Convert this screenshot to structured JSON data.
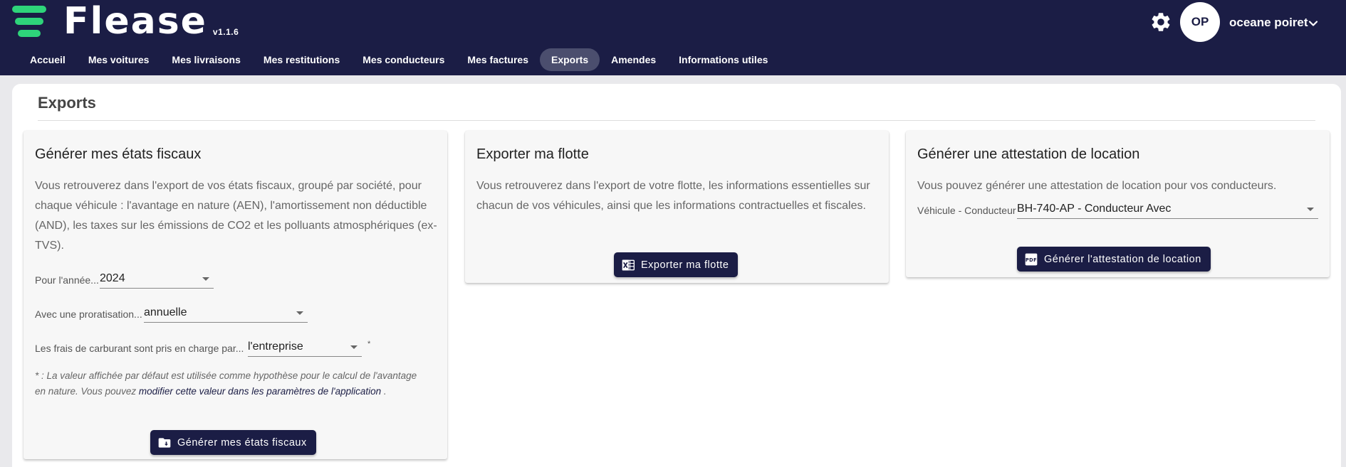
{
  "app": {
    "logo_text": "Flease",
    "version": "v1.1.6",
    "brand_color": "#1b1d45",
    "accent_color": "#2ed47a"
  },
  "user": {
    "initials": "OP",
    "name": "oceane poiret"
  },
  "nav": {
    "items": [
      {
        "label": "Accueil"
      },
      {
        "label": "Mes voitures"
      },
      {
        "label": "Mes livraisons"
      },
      {
        "label": "Mes restitutions"
      },
      {
        "label": "Mes conducteurs"
      },
      {
        "label": "Mes factures"
      },
      {
        "label": "Exports",
        "active": true
      },
      {
        "label": "Amendes"
      },
      {
        "label": "Informations utiles"
      }
    ]
  },
  "page": {
    "title": "Exports"
  },
  "fiscal": {
    "title": "Générer mes états fiscaux",
    "description": "Vous retrouverez dans l'export de vos états fiscaux, groupé par société, pour chaque véhicule : l'avantage en nature (AEN), l'amortissement non déductible (AND), les taxes sur les émissions de CO2 et les polluants atmosphériques (ex-TVS).",
    "year_label": "Pour l'année...",
    "year_value": "2024",
    "proration_label": "Avec une proratisation...",
    "proration_value": "annuelle",
    "fuel_label": "Les frais de carburant sont pris en charge par...",
    "fuel_value": "l'entreprise",
    "fuel_star": "*",
    "note_prefix": "* : La valeur affichée par défaut est utilisée comme hypothèse pour le calcul de l'avantage en nature. Vous pouvez",
    "note_link": "modifier cette valeur dans les paramètres de l'application",
    "note_suffix": ".",
    "button_label": "Générer mes états fiscaux",
    "button_icon": "folder-download-icon"
  },
  "fleet": {
    "title": "Exporter ma flotte",
    "description": "Vous retrouverez dans l'export de votre flotte, les informations essentielles sur chacun de vos véhicules, ainsi que les informations contractuelles et fiscales.",
    "button_label": "Exporter ma flotte",
    "button_icon": "excel-icon"
  },
  "attestation": {
    "title": "Générer une attestation de location",
    "description": "Vous pouvez générer une attestation de location pour vos conducteurs.",
    "vehicle_label": "Véhicule - Conducteur",
    "vehicle_value": "BH-740-AP - Conducteur Avec",
    "button_label": "Générer l'attestation de location",
    "button_icon": "pdf-icon"
  }
}
